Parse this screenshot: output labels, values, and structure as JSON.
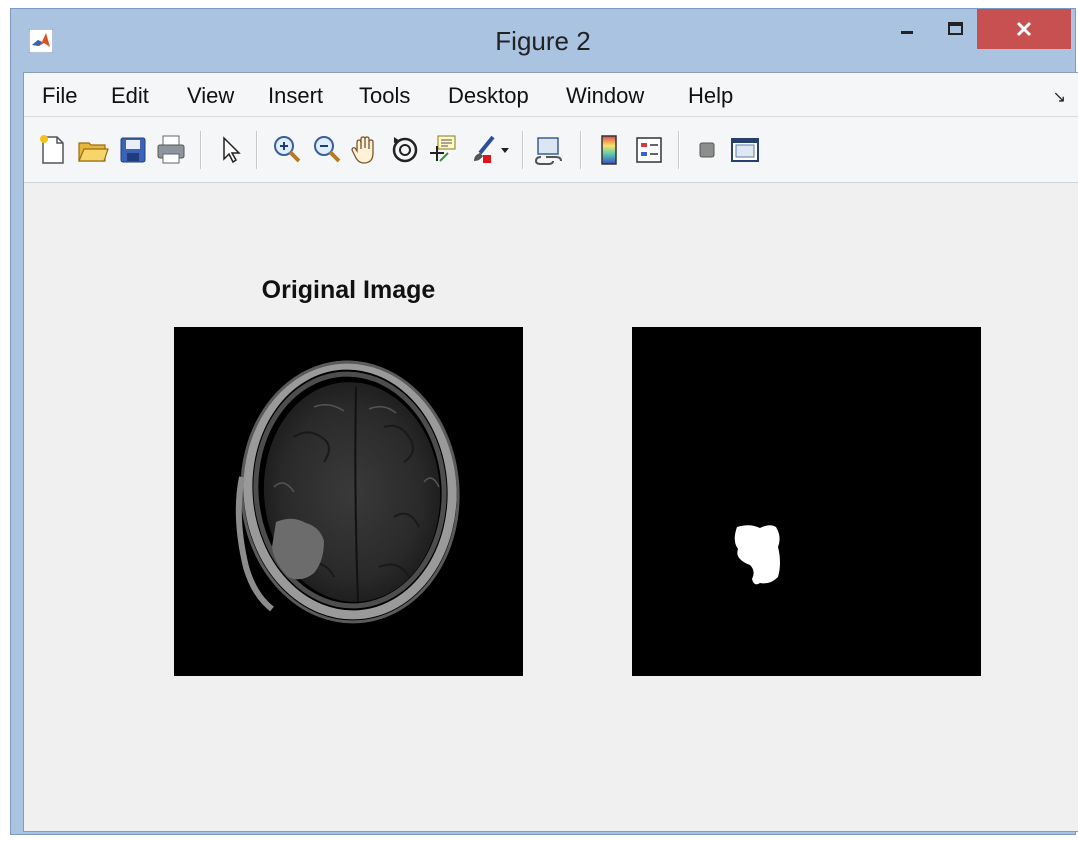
{
  "window": {
    "title": "Figure 2"
  },
  "menu": [
    "File",
    "Edit",
    "View",
    "Insert",
    "Tools",
    "Desktop",
    "Window",
    "Help"
  ],
  "toolbar_icons": [
    "new-figure-icon",
    "open-file-icon",
    "save-icon",
    "print-icon",
    "edit-plot-arrow-icon",
    "zoom-in-icon",
    "zoom-out-icon",
    "pan-hand-icon",
    "rotate-3d-icon",
    "data-cursor-icon",
    "brush-icon",
    "brush-dropdown-icon",
    "link-plot-icon",
    "insert-colorbar-icon",
    "insert-legend-icon",
    "hide-plot-tools-icon",
    "show-plot-tools-icon"
  ],
  "axes": [
    {
      "title": "Original Image",
      "content": "Brain MRI axial slice"
    },
    {
      "title": "",
      "content": "Binary tumor segmentation mask"
    }
  ],
  "colors": {
    "titlebar": "#a9c3e1",
    "close": "#c75050",
    "figure_bg": "#f0f0f0"
  }
}
